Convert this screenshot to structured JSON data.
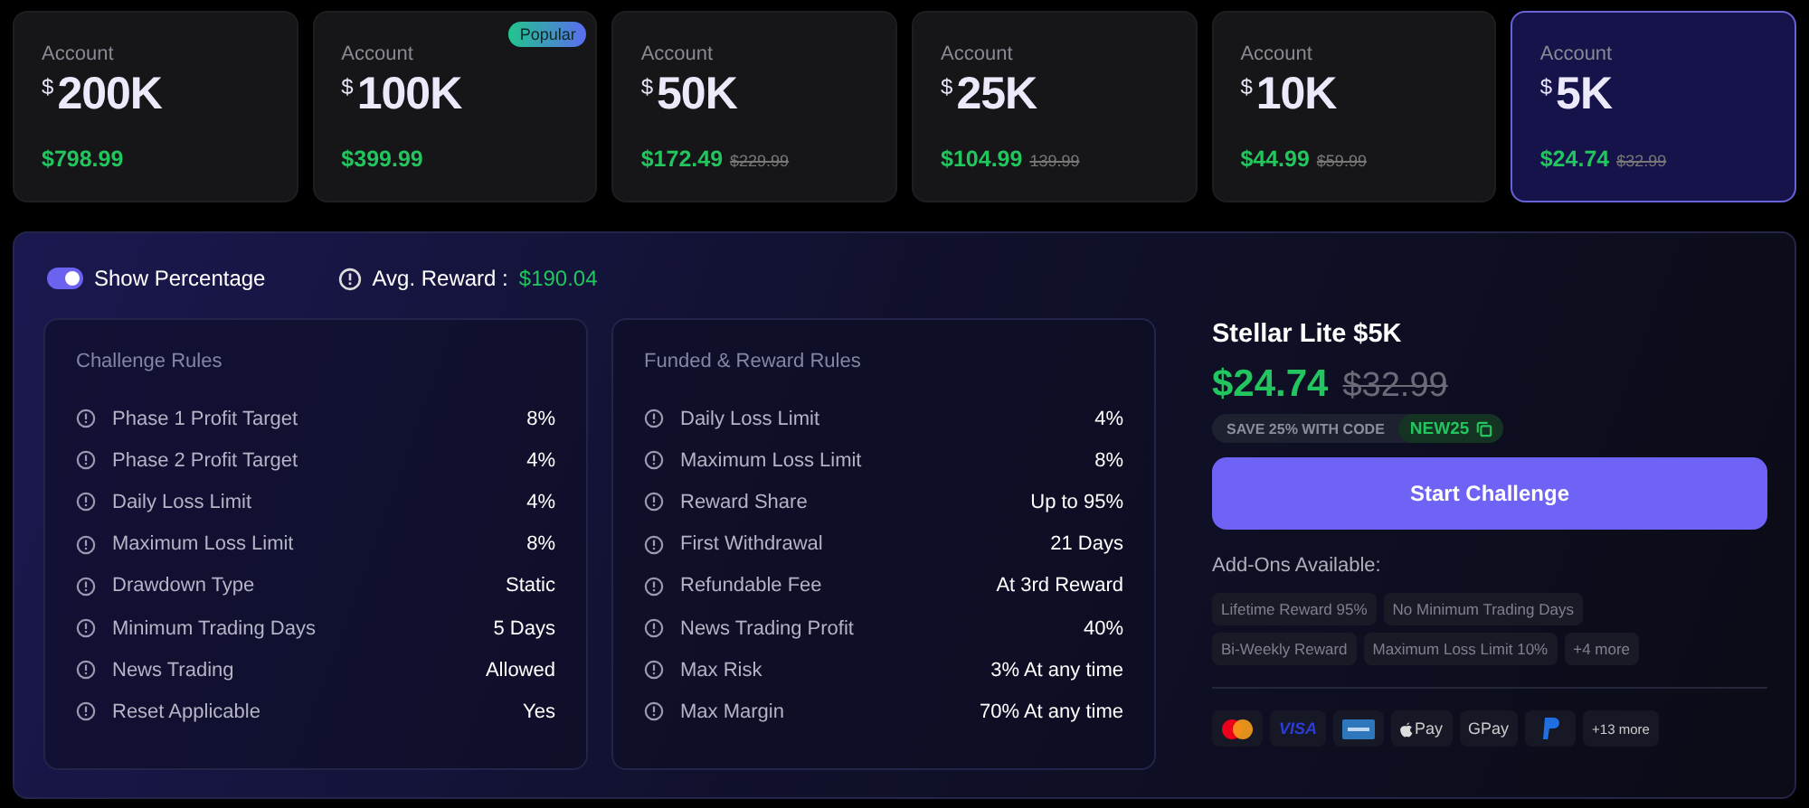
{
  "cards": [
    {
      "label": "Account",
      "currency": "$",
      "amount": "200K",
      "price": "$798.99",
      "selected": false
    },
    {
      "label": "Account",
      "currency": "$",
      "amount": "100K",
      "price": "$399.99",
      "badge": "Popular",
      "selected": false
    },
    {
      "label": "Account",
      "currency": "$",
      "amount": "50K",
      "price": "$172.49",
      "old_price": "$229.99",
      "selected": false
    },
    {
      "label": "Account",
      "currency": "$",
      "amount": "25K",
      "price": "$104.99",
      "old_price": "139.99",
      "selected": false
    },
    {
      "label": "Account",
      "currency": "$",
      "amount": "10K",
      "price": "$44.99",
      "old_price": "$59.99",
      "selected": false
    },
    {
      "label": "Account",
      "currency": "$",
      "amount": "5K",
      "price": "$24.74",
      "old_price": "$32.99",
      "selected": true
    }
  ],
  "toggle": {
    "label": "Show Percentage",
    "on": true
  },
  "avg_reward": {
    "label": "Avg. Reward :",
    "value": "$190.04"
  },
  "rule_panels": [
    {
      "title": "Challenge Rules",
      "rows": [
        {
          "label": "Phase 1 Profit Target",
          "value": "8%"
        },
        {
          "label": "Phase 2 Profit Target",
          "value": "4%"
        },
        {
          "label": "Daily Loss Limit",
          "value": "4%"
        },
        {
          "label": "Maximum Loss Limit",
          "value": "8%"
        },
        {
          "label": "Drawdown Type",
          "value": "Static"
        },
        {
          "label": "Minimum Trading Days",
          "value": "5 Days"
        },
        {
          "label": "News Trading",
          "value": "Allowed"
        },
        {
          "label": "Reset Applicable",
          "value": "Yes"
        }
      ]
    },
    {
      "title": "Funded & Reward Rules",
      "rows": [
        {
          "label": "Daily Loss Limit",
          "value": "4%"
        },
        {
          "label": "Maximum Loss Limit",
          "value": "8%"
        },
        {
          "label": "Reward Share",
          "value": "Up to 95%"
        },
        {
          "label": "First Withdrawal",
          "value": "21 Days"
        },
        {
          "label": "Refundable Fee",
          "value": "At 3rd Reward"
        },
        {
          "label": "News Trading Profit",
          "value": "40%"
        },
        {
          "label": "Max Risk",
          "value": "3% At any time"
        },
        {
          "label": "Max Margin",
          "value": "70% At any time"
        }
      ]
    }
  ],
  "plan": {
    "title": "Stellar Lite $5K",
    "price": "$24.74",
    "old_price": "$32.99",
    "promo": {
      "text": "SAVE 25% WITH CODE",
      "code": "NEW25"
    },
    "button": "Start Challenge",
    "addons_title": "Add-Ons Available:",
    "addons": [
      "Lifetime Reward 95%",
      "No Minimum Trading Days",
      "Bi-Weekly Reward",
      "Maximum Loss Limit 10%",
      "+4 more"
    ],
    "payments": [
      {
        "kind": "mastercard"
      },
      {
        "kind": "visa",
        "text": "VISA"
      },
      {
        "kind": "amex"
      },
      {
        "kind": "applepay",
        "text": "Pay"
      },
      {
        "kind": "gpay",
        "text": "GPay"
      },
      {
        "kind": "paypal"
      },
      {
        "kind": "more",
        "text": "+13 more"
      }
    ]
  }
}
